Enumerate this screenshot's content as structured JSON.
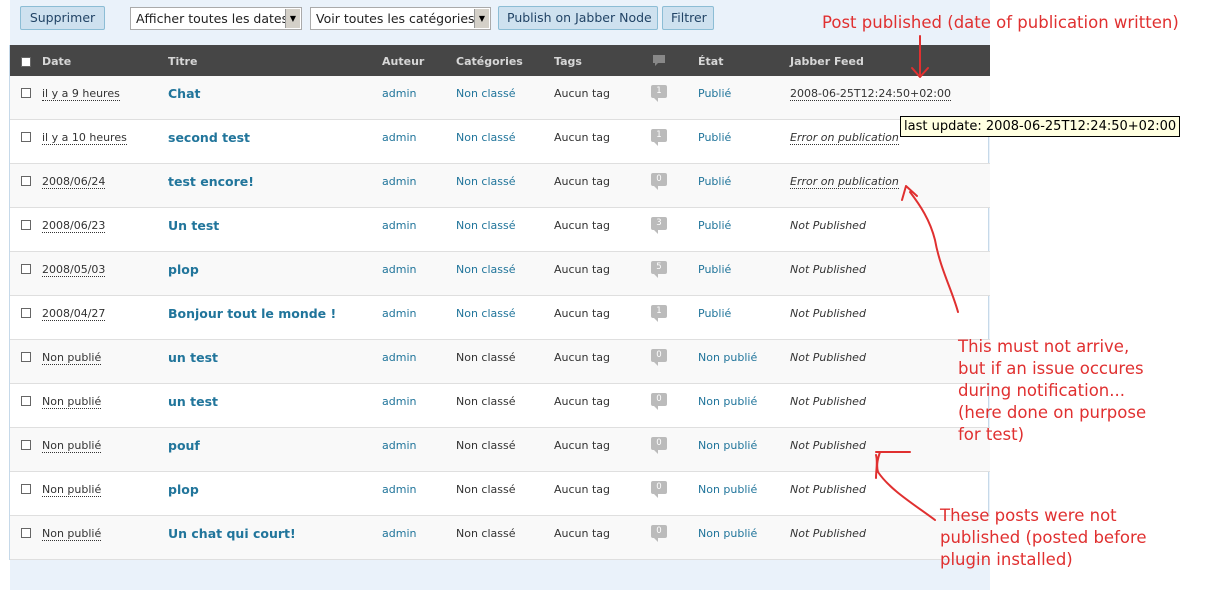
{
  "toolbar": {
    "delete_label": "Supprimer",
    "dates_select": "Afficher toutes les dates",
    "categories_select": "Voir toutes les catégories",
    "publish_label": "Publish on Jabber Node",
    "filter_label": "Filtrer"
  },
  "columns": {
    "date": "Date",
    "title": "Titre",
    "author": "Auteur",
    "categories": "Catégories",
    "tags": "Tags",
    "comments_icon": "comment-bubble-icon",
    "status": "État",
    "feed": "Jabber Feed"
  },
  "rows": [
    {
      "date": "il y a 9 heures",
      "title": "Chat",
      "author": "admin",
      "category": "Non classé",
      "category_linked": true,
      "tags": "Aucun tag",
      "comments": "1",
      "status": "Publié",
      "feed": "2008-06-25T12:24:50+02:00",
      "feed_type": "date"
    },
    {
      "date": "il y a 10 heures",
      "title": "second test",
      "author": "admin",
      "category": "Non classé",
      "category_linked": true,
      "tags": "Aucun tag",
      "comments": "1",
      "status": "Publié",
      "feed": "Error on publication",
      "feed_type": "error"
    },
    {
      "date": "2008/06/24",
      "title": "test encore!",
      "author": "admin",
      "category": "Non classé",
      "category_linked": true,
      "tags": "Aucun tag",
      "comments": "0",
      "status": "Publié",
      "feed": "Error on publication",
      "feed_type": "error"
    },
    {
      "date": "2008/06/23",
      "title": "Un test",
      "author": "admin",
      "category": "Non classé",
      "category_linked": true,
      "tags": "Aucun tag",
      "comments": "3",
      "status": "Publié",
      "feed": "Not Published",
      "feed_type": "np"
    },
    {
      "date": "2008/05/03",
      "title": "plop",
      "author": "admin",
      "category": "Non classé",
      "category_linked": true,
      "tags": "Aucun tag",
      "comments": "5",
      "status": "Publié",
      "feed": "Not Published",
      "feed_type": "np"
    },
    {
      "date": "2008/04/27",
      "title": "Bonjour tout le monde !",
      "author": "admin",
      "category": "Non classé",
      "category_linked": true,
      "tags": "Aucun tag",
      "comments": "1",
      "status": "Publié",
      "feed": "Not Published",
      "feed_type": "np"
    },
    {
      "date": "Non publié",
      "title": "un test",
      "author": "admin",
      "category": "Non classé",
      "category_linked": false,
      "tags": "Aucun tag",
      "comments": "0",
      "status": "Non publié",
      "feed": "Not Published",
      "feed_type": "np"
    },
    {
      "date": "Non publié",
      "title": "un test",
      "author": "admin",
      "category": "Non classé",
      "category_linked": false,
      "tags": "Aucun tag",
      "comments": "0",
      "status": "Non publié",
      "feed": "Not Published",
      "feed_type": "np"
    },
    {
      "date": "Non publié",
      "title": "pouf",
      "author": "admin",
      "category": "Non classé",
      "category_linked": false,
      "tags": "Aucun tag",
      "comments": "0",
      "status": "Non publié",
      "feed": "Not Published",
      "feed_type": "np"
    },
    {
      "date": "Non publié",
      "title": "plop",
      "author": "admin",
      "category": "Non classé",
      "category_linked": false,
      "tags": "Aucun tag",
      "comments": "0",
      "status": "Non publié",
      "feed": "Not Published",
      "feed_type": "np"
    },
    {
      "date": "Non publié",
      "title": "Un chat qui court!",
      "author": "admin",
      "category": "Non classé",
      "category_linked": false,
      "tags": "Aucun tag",
      "comments": "0",
      "status": "Non publié",
      "feed": "Not Published",
      "feed_type": "np"
    }
  ],
  "tooltip": "last update: 2008-06-25T12:24:50+02:00",
  "annotations": {
    "published": "Post published (date of publication written)",
    "error": [
      "This must not arrive,",
      "but if an issue occures",
      "during notification...",
      "(here done on purpose",
      "for test)"
    ],
    "not_published": [
      "These posts were not",
      "published (posted before",
      "plugin installed)"
    ]
  },
  "colors": {
    "link": "#21759b",
    "header_bg": "#464646",
    "annotation": "#e03030",
    "button_bg": "#cee1ef"
  }
}
